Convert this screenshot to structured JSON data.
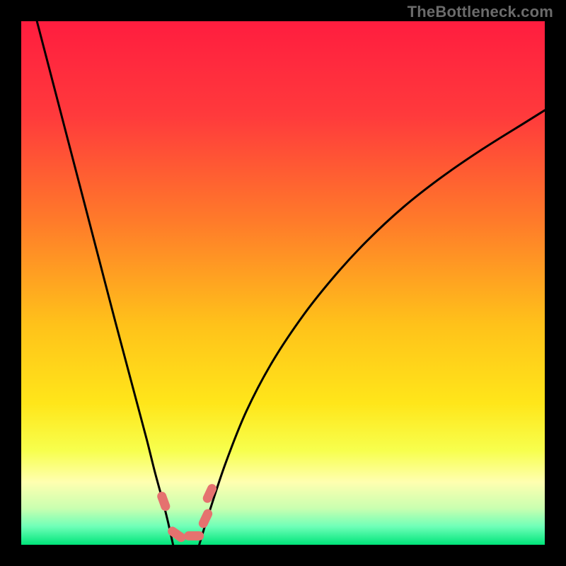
{
  "watermark": "TheBottleneck.com",
  "chart_data": {
    "type": "line",
    "title": "",
    "xlabel": "",
    "ylabel": "",
    "xlim": [
      0,
      100
    ],
    "ylim": [
      0,
      100
    ],
    "gradient_stops": [
      {
        "offset": 0.0,
        "color": "#ff1d3f"
      },
      {
        "offset": 0.18,
        "color": "#ff3a3c"
      },
      {
        "offset": 0.38,
        "color": "#ff7a2a"
      },
      {
        "offset": 0.58,
        "color": "#ffc21a"
      },
      {
        "offset": 0.73,
        "color": "#ffe61a"
      },
      {
        "offset": 0.82,
        "color": "#f7ff4d"
      },
      {
        "offset": 0.88,
        "color": "#ffffb0"
      },
      {
        "offset": 0.93,
        "color": "#caffb0"
      },
      {
        "offset": 0.965,
        "color": "#6fffb8"
      },
      {
        "offset": 1.0,
        "color": "#00e57a"
      }
    ],
    "series": [
      {
        "name": "left-branch",
        "x": [
          3.0,
          6.0,
          9.0,
          12.0,
          15.0,
          18.0,
          20.0,
          22.0,
          24.0,
          25.5,
          27.0,
          28.0,
          29.0
        ],
        "y": [
          100.0,
          88.5,
          77.0,
          65.5,
          54.0,
          42.5,
          35.0,
          27.5,
          20.0,
          14.0,
          8.5,
          4.5,
          0.0
        ]
      },
      {
        "name": "right-branch",
        "x": [
          34.0,
          36.0,
          39.0,
          43.0,
          48.0,
          54.0,
          60.0,
          66.0,
          73.0,
          80.0,
          88.0,
          96.0,
          100.0
        ],
        "y": [
          0.0,
          6.5,
          15.5,
          25.5,
          35.0,
          44.0,
          51.5,
          58.0,
          64.5,
          70.0,
          75.5,
          80.5,
          83.0
        ]
      }
    ],
    "optimal_zone": {
      "x_start": 27.0,
      "x_end": 36.0,
      "on_baseline": true
    },
    "markers": [
      {
        "name": "pill-left",
        "cx": 27.2,
        "cy": 8.3,
        "rot_deg": 70
      },
      {
        "name": "pill-mid-left",
        "cx": 29.7,
        "cy": 2.0,
        "rot_deg": 35
      },
      {
        "name": "pill-mid-right",
        "cx": 33.0,
        "cy": 1.7,
        "rot_deg": 0
      },
      {
        "name": "pill-right-low",
        "cx": 35.2,
        "cy": 5.0,
        "rot_deg": -65
      },
      {
        "name": "pill-right-up",
        "cx": 36.0,
        "cy": 9.8,
        "rot_deg": -65
      }
    ],
    "annotations": []
  }
}
